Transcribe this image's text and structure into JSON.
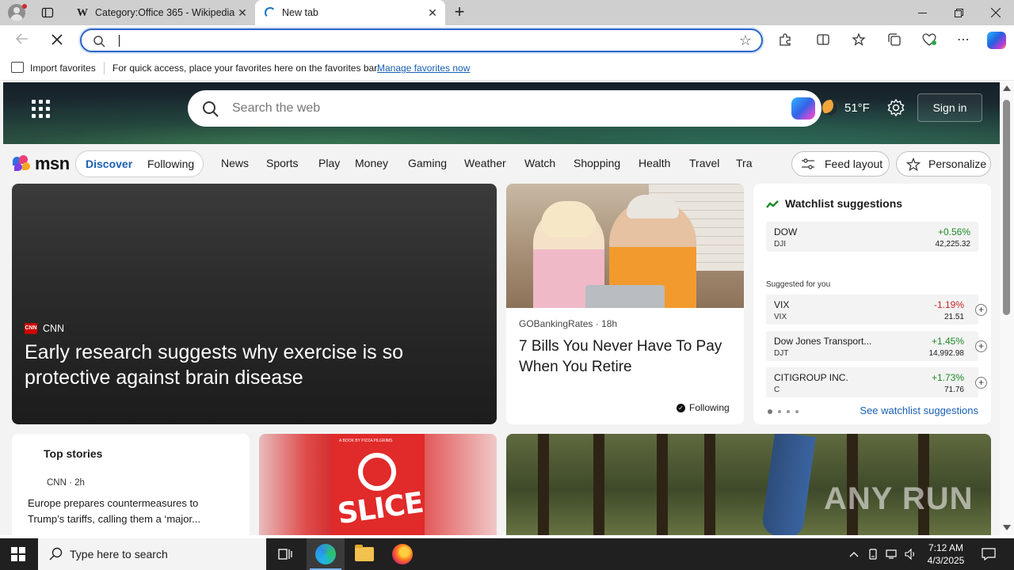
{
  "browser": {
    "tabs": [
      {
        "title": "Category:Office 365 - Wikipedia",
        "favicon": "W"
      },
      {
        "title": "New tab"
      }
    ],
    "new_tab_glyph": "+",
    "close_glyph": "✕"
  },
  "address_bar": {
    "value": "",
    "placeholder": ""
  },
  "favorites_bar": {
    "import_label": "Import favorites",
    "hint": "For quick access, place your favorites here on the favorites bar.",
    "manage_link": "Manage favorites now"
  },
  "msn_header": {
    "search_placeholder": "Search the web",
    "temperature": "51°F",
    "sign_in": "Sign in"
  },
  "msn_nav": {
    "logo": "msn",
    "pills": [
      "Discover",
      "Following"
    ],
    "categories": [
      "News",
      "Sports",
      "Play",
      "Money",
      "Gaming",
      "Weather",
      "Watch",
      "Shopping",
      "Health",
      "Travel",
      "Traffic"
    ],
    "feed_layout": "Feed layout",
    "personalize": "Personalize"
  },
  "hero_story": {
    "source": "CNN",
    "logo_text": "CNN",
    "headline": "Early research suggests why exercise is so protective against brain disease"
  },
  "side_story": {
    "source": "GOBankingRates",
    "age": "18h",
    "headline": "7 Bills You Never Have To Pay When You Retire",
    "following": "Following"
  },
  "watchlist": {
    "title": "Watchlist suggestions",
    "main": {
      "symbol": "DOW",
      "sub": "DJI",
      "change": "+0.56%",
      "price": "42,225.32"
    },
    "suggested_label": "Suggested for you",
    "suggested": [
      {
        "symbol": "VIX",
        "sub": "VIX",
        "change": "-1.19%",
        "price": "21.51",
        "direction": "down"
      },
      {
        "symbol": "Dow Jones Transport...",
        "sub": "DJT",
        "change": "+1.45%",
        "price": "14,992.98",
        "direction": "up"
      },
      {
        "symbol": "CITIGROUP INC.",
        "sub": "C",
        "change": "+1.73%",
        "price": "71.76",
        "direction": "up"
      }
    ],
    "see_all": "See watchlist suggestions"
  },
  "top_stories": {
    "title": "Top stories",
    "source": "CNN · 2h",
    "headline": "Europe prepares countermeasures to Trump’s tariffs, calling them a ‘major..."
  },
  "book_card": {
    "byline": "A BOOK BY PIZZA PILGRIMS",
    "word": "SLICE"
  },
  "watermark": "ANY RUN",
  "taskbar": {
    "search_placeholder": "Type here to search",
    "time": "7:12 AM",
    "date": "4/3/2025"
  },
  "colors": {
    "accent": "#1a5fb4",
    "positive": "#1e8a28",
    "negative": "#c62828",
    "taskbar": "#202020"
  }
}
